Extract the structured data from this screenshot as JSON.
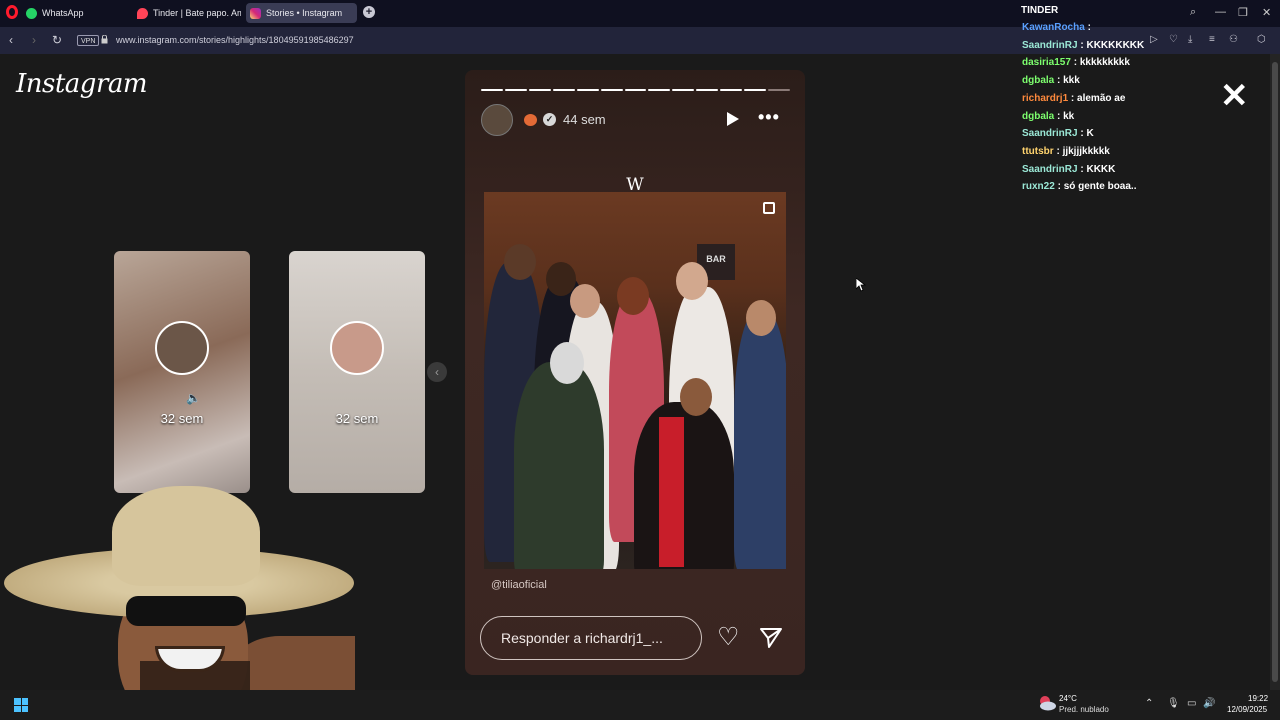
{
  "browser": {
    "tabs": [
      {
        "label": "WhatsApp",
        "color": "#25d366"
      },
      {
        "label": "Tinder | Bate papo. Amiza",
        "color": "#ff4458"
      },
      {
        "label": "Stories • Instagram",
        "color": "#d6249f"
      }
    ],
    "vpn_label": "VPN",
    "url": "www.instagram.com/stories/highlights/18049591985486297"
  },
  "instagram": {
    "logo_text": "Instagram",
    "previews": [
      {
        "time": "32 sem"
      },
      {
        "time": "32 sem"
      }
    ],
    "story": {
      "time": "44 sem",
      "overlay_text": "W",
      "bar_sign": "BAR",
      "mention": "@tiliaoficial",
      "reply_placeholder": "Responder a richardrj1_..."
    }
  },
  "chat": {
    "title": "TINDER",
    "messages": [
      {
        "user": "KawanRocha",
        "text": "",
        "color": "#5aa0ff"
      },
      {
        "user": "SaandrinRJ",
        "text": "KKKKKKKK",
        "color": "#9be8d6"
      },
      {
        "user": "dasiria157",
        "text": "kkkkkkkkk",
        "color": "#7dff6e"
      },
      {
        "user": "dgbala",
        "text": "kkk",
        "color": "#7dff6e"
      },
      {
        "user": "richardrj1",
        "text": "alemão ae",
        "color": "#ff8a3d"
      },
      {
        "user": "dgbala",
        "text": "kk",
        "color": "#7dff6e"
      },
      {
        "user": "SaandrinRJ",
        "text": "K",
        "color": "#9be8d6"
      },
      {
        "user": "ttutsbr",
        "text": "jjkjjjkkkkk",
        "color": "#ffd36e"
      },
      {
        "user": "SaandrinRJ",
        "text": "KKKK",
        "color": "#9be8d6"
      },
      {
        "user": "ruxn22",
        "text": "só gente boaa..",
        "color": "#9be8d6"
      }
    ]
  },
  "taskbar": {
    "weather_temp": "24°C",
    "weather_desc": "Pred. nublado",
    "time": "19:22",
    "date": "12/09/2025"
  }
}
